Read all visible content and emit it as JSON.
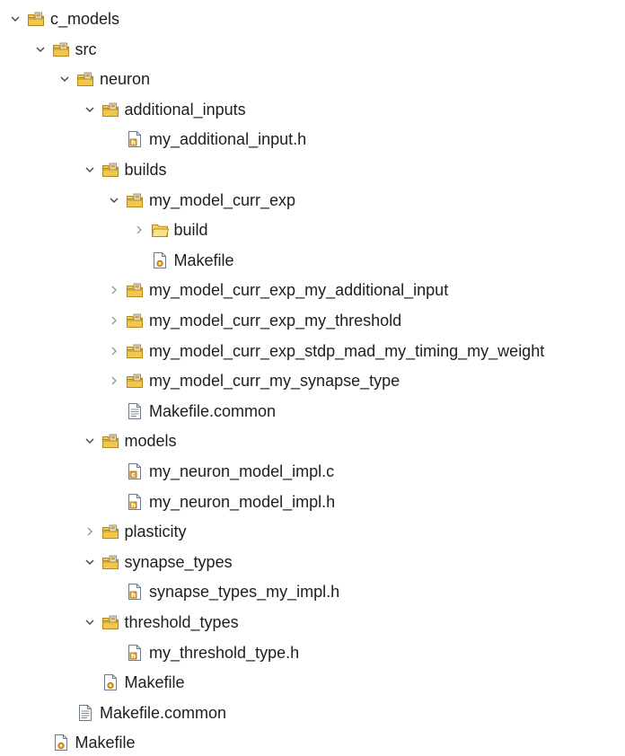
{
  "tree": {
    "items": [
      {
        "label": "c_models",
        "depth": 0,
        "toggle": "expanded",
        "icon": "package-folder-icon"
      },
      {
        "label": "src",
        "depth": 1,
        "toggle": "expanded",
        "icon": "package-folder-icon"
      },
      {
        "label": "neuron",
        "depth": 2,
        "toggle": "expanded",
        "icon": "package-folder-icon"
      },
      {
        "label": "additional_inputs",
        "depth": 3,
        "toggle": "expanded",
        "icon": "package-folder-icon"
      },
      {
        "label": "my_additional_input.h",
        "depth": 4,
        "toggle": "none",
        "icon": "header-file-icon"
      },
      {
        "label": "builds",
        "depth": 3,
        "toggle": "expanded",
        "icon": "package-folder-icon"
      },
      {
        "label": "my_model_curr_exp",
        "depth": 4,
        "toggle": "expanded",
        "icon": "package-folder-icon"
      },
      {
        "label": "build",
        "depth": 5,
        "toggle": "collapsed",
        "icon": "folder-icon"
      },
      {
        "label": "Makefile",
        "depth": 5,
        "toggle": "none",
        "icon": "makefile-icon"
      },
      {
        "label": "my_model_curr_exp_my_additional_input",
        "depth": 4,
        "toggle": "collapsed",
        "icon": "package-folder-icon"
      },
      {
        "label": "my_model_curr_exp_my_threshold",
        "depth": 4,
        "toggle": "collapsed",
        "icon": "package-folder-icon"
      },
      {
        "label": "my_model_curr_exp_stdp_mad_my_timing_my_weight",
        "depth": 4,
        "toggle": "collapsed",
        "icon": "package-folder-icon"
      },
      {
        "label": "my_model_curr_my_synapse_type",
        "depth": 4,
        "toggle": "collapsed",
        "icon": "package-folder-icon"
      },
      {
        "label": "Makefile.common",
        "depth": 4,
        "toggle": "none",
        "icon": "text-file-icon"
      },
      {
        "label": "models",
        "depth": 3,
        "toggle": "expanded",
        "icon": "package-folder-icon"
      },
      {
        "label": "my_neuron_model_impl.c",
        "depth": 4,
        "toggle": "none",
        "icon": "c-source-file-icon"
      },
      {
        "label": "my_neuron_model_impl.h",
        "depth": 4,
        "toggle": "none",
        "icon": "header-file-icon"
      },
      {
        "label": "plasticity",
        "depth": 3,
        "toggle": "collapsed",
        "icon": "package-folder-icon"
      },
      {
        "label": "synapse_types",
        "depth": 3,
        "toggle": "expanded",
        "icon": "package-folder-icon"
      },
      {
        "label": "synapse_types_my_impl.h",
        "depth": 4,
        "toggle": "none",
        "icon": "header-file-icon"
      },
      {
        "label": "threshold_types",
        "depth": 3,
        "toggle": "expanded",
        "icon": "package-folder-icon"
      },
      {
        "label": "my_threshold_type.h",
        "depth": 4,
        "toggle": "none",
        "icon": "header-file-icon"
      },
      {
        "label": "Makefile",
        "depth": 3,
        "toggle": "none",
        "icon": "makefile-icon"
      },
      {
        "label": "Makefile.common",
        "depth": 2,
        "toggle": "none",
        "icon": "text-file-icon"
      },
      {
        "label": "Makefile",
        "depth": 1,
        "toggle": "none",
        "icon": "makefile-icon"
      }
    ]
  }
}
